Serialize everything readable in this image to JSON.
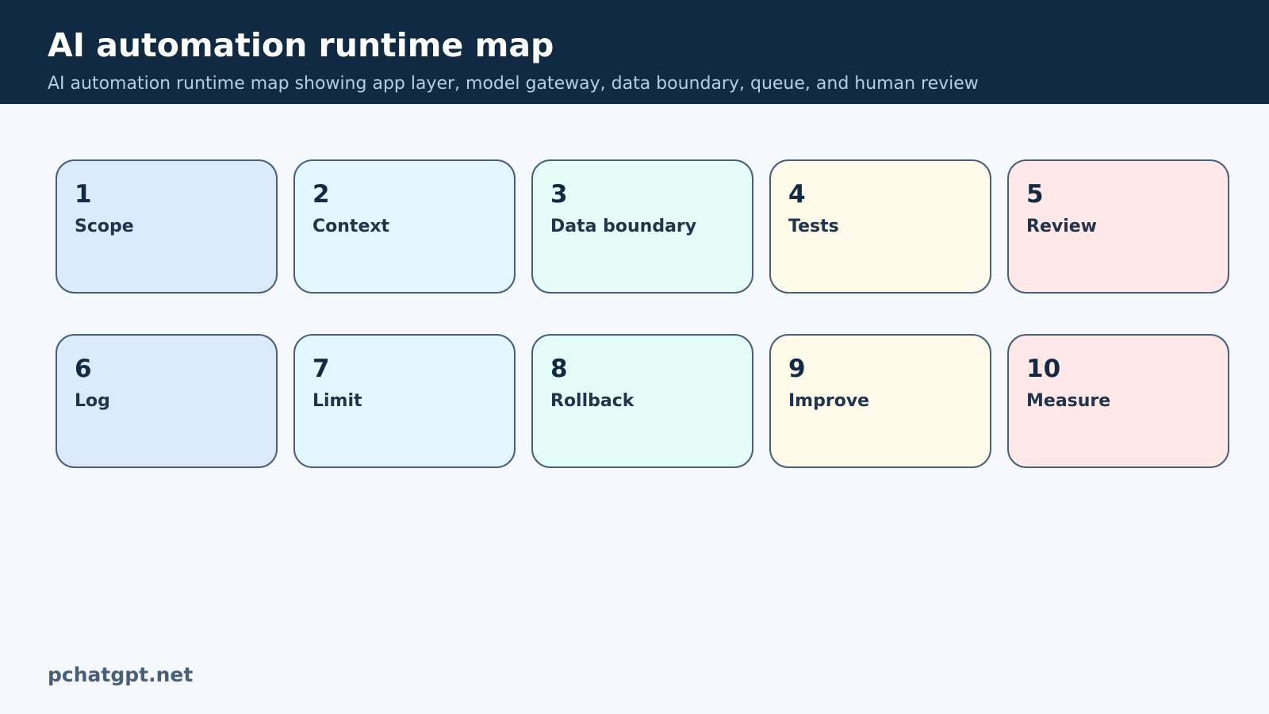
{
  "header": {
    "title": "AI automation runtime map",
    "subtitle": "AI automation runtime map showing app layer, model gateway, data boundary, queue, and human review"
  },
  "cards": [
    {
      "number": "1",
      "label": "Scope",
      "color": "#dceafd"
    },
    {
      "number": "2",
      "label": "Context",
      "color": "#e2f7fe"
    },
    {
      "number": "3",
      "label": "Data boundary",
      "color": "#e4fdf8"
    },
    {
      "number": "4",
      "label": "Tests",
      "color": "#fefbeb"
    },
    {
      "number": "5",
      "label": "Review",
      "color": "#ffe8e8"
    },
    {
      "number": "6",
      "label": "Log",
      "color": "#dceafd"
    },
    {
      "number": "7",
      "label": "Limit",
      "color": "#e2f7fe"
    },
    {
      "number": "8",
      "label": "Rollback",
      "color": "#e4fdf8"
    },
    {
      "number": "9",
      "label": "Improve",
      "color": "#fefbeb"
    },
    {
      "number": "10",
      "label": "Measure",
      "color": "#ffe8e8"
    }
  ],
  "footer": {
    "brand": "pchatgpt.net"
  },
  "colors": {
    "header_bg": "#102a44",
    "page_bg": "#f5f9fd",
    "card_border": "#485f7a"
  }
}
